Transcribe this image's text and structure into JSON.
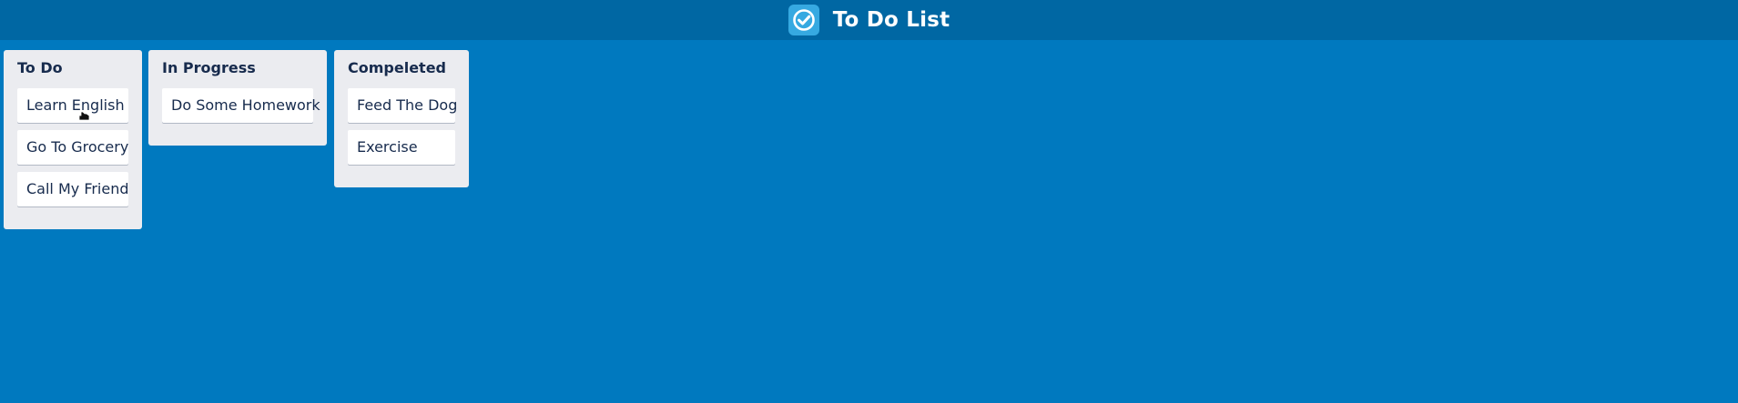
{
  "header": {
    "title": "To Do List",
    "logo_icon": "check-circle-icon"
  },
  "colors": {
    "board_background": "#0079bf",
    "header_background": "#0067a3",
    "logo_background": "#36a9e1",
    "list_background": "#ebecf0",
    "card_background": "#ffffff",
    "text": "#172b4d"
  },
  "lists": [
    {
      "title": "To Do",
      "cards": [
        "Learn English",
        "Go To Grocery",
        "Call My Friend"
      ]
    },
    {
      "title": "In Progress",
      "cards": [
        "Do Some Homework"
      ]
    },
    {
      "title": "Compeleted",
      "cards": [
        "Feed The Dog",
        "Exercise"
      ]
    }
  ]
}
